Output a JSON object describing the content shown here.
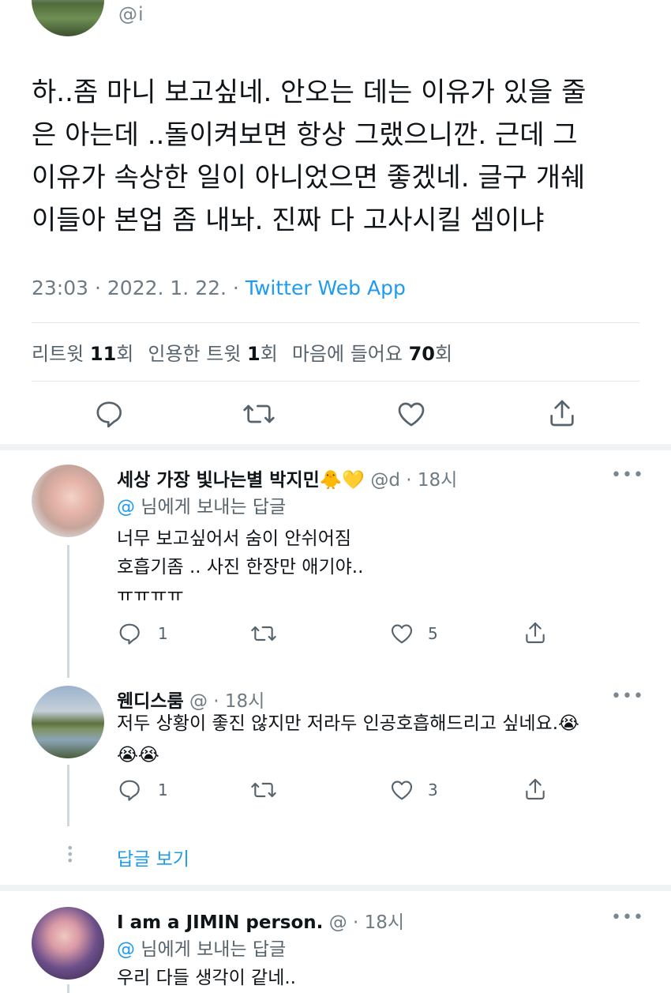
{
  "main_tweet": {
    "handle": "@i",
    "lines": [
      "하..좀 마니 보고싶네. 안오는 데는 이유가 있을 줄",
      "은 아는데 ..돌이켜보면 항상 그랬으니깐. 근데 그",
      "이유가 속상한 일이 아니었으면 좋겠네. 글구 개쉐",
      "이들아 본업 좀 내놔. 진짜 다 고사시킬 셈이냐"
    ],
    "time": "23:03 · 2022. 1. 22. · ",
    "app": "Twitter Web App",
    "stats": {
      "retweets_label": "리트윗 ",
      "retweets_count": "11",
      "retweets_unit": "회",
      "quotes_label": "인용한 트윗 ",
      "quotes_count": "1",
      "quotes_unit": "회",
      "likes_label": "마음에 들어요 ",
      "likes_count": "70",
      "likes_unit": "회"
    }
  },
  "replies": [
    {
      "name": "세상 가장 빛나는별 박지민🐥💛",
      "handle": "@d · 18시",
      "reply_to_handle": "@",
      "reply_to_suffix": " 님에게 보내는 답글",
      "lines": [
        "너무 보고싶어서 숨이 안쉬어짐",
        "호흡기좀 .. 사진 한장만 애기야..",
        "ㅠㅠㅠㅠ"
      ],
      "reply_count": "1",
      "like_count": "5"
    },
    {
      "name": "웬디스룸",
      "handle": "@ · 18시",
      "lines": [
        "저두 상황이 좋진 않지만 저라두 인공호흡해드리고 싶네요.😭",
        "😭😭"
      ],
      "reply_count": "1",
      "like_count": "3"
    },
    {
      "name": "I am a JIMIN person.",
      "handle": "@ · 18시",
      "reply_to_handle": "@",
      "reply_to_suffix": " 님에게 보내는 답글",
      "lines": [
        "우리 다들 생각이 같네.."
      ]
    }
  ],
  "show_replies_label": "답글 보기",
  "more_label": "•••",
  "icons": [
    "reply-icon",
    "retweet-icon",
    "like-icon",
    "share-icon",
    "more-icon"
  ],
  "colors": {
    "accent": "#1d9bf0",
    "text": "#0f1419",
    "muted": "#6e7b85",
    "divider": "#e1e6ea"
  }
}
